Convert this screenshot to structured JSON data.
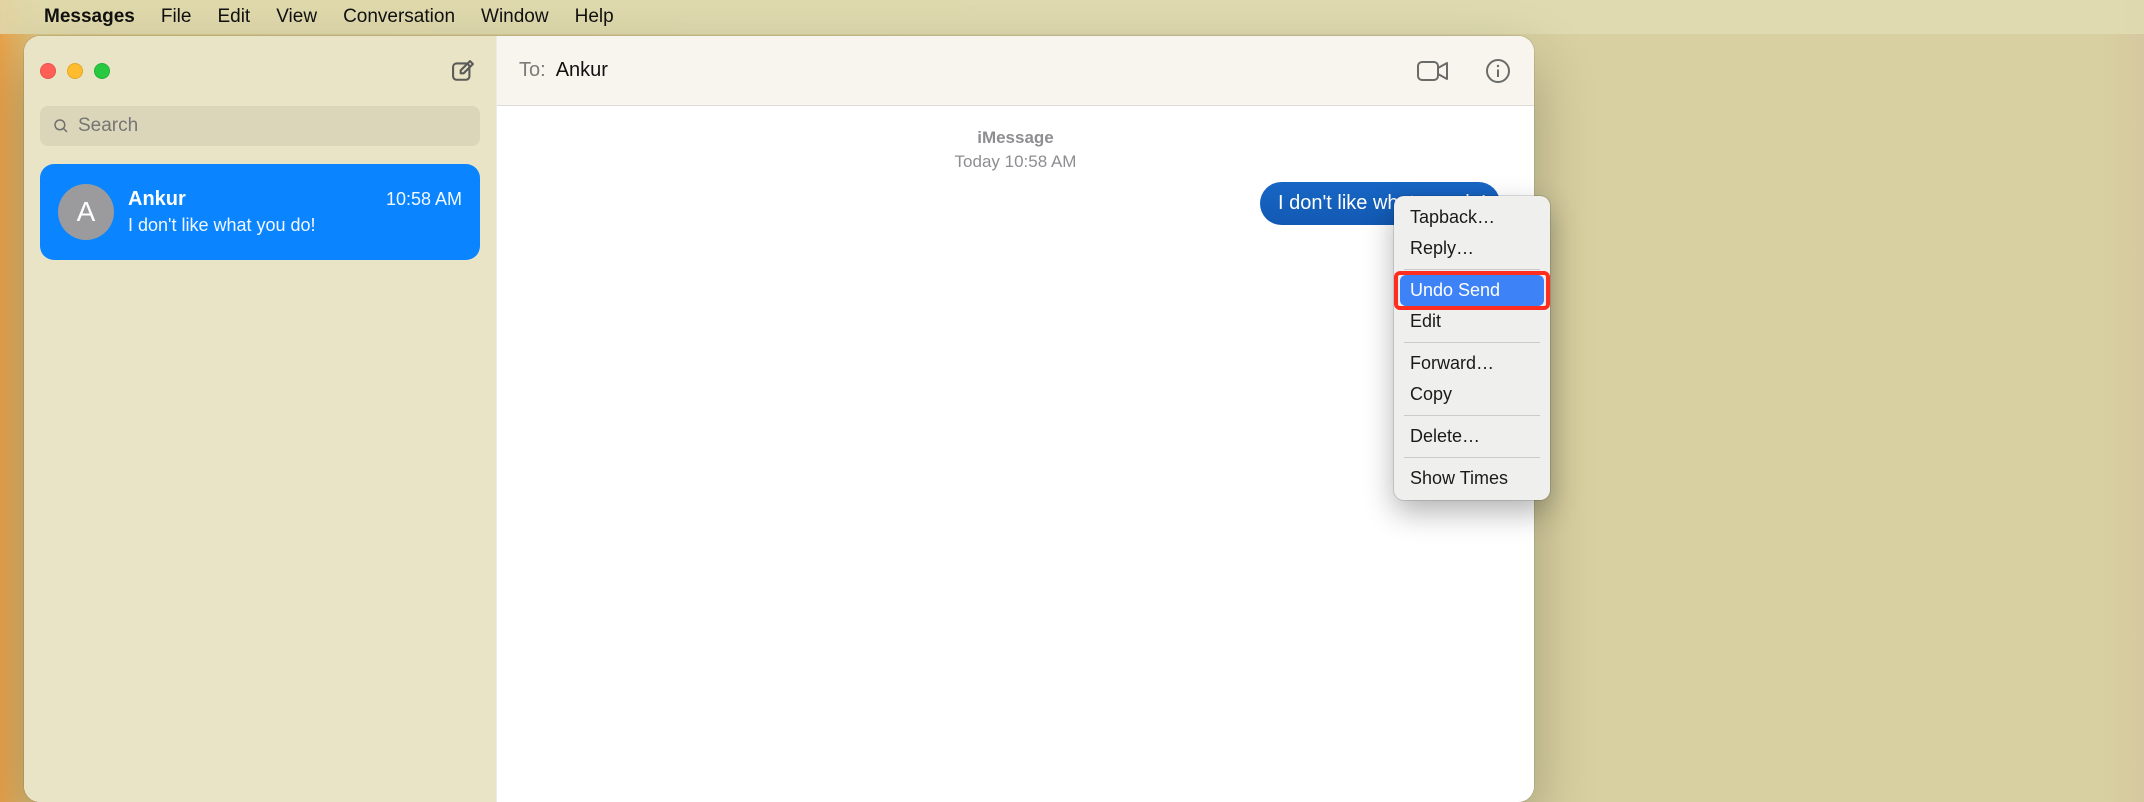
{
  "menubar": {
    "app": "Messages",
    "items": [
      "File",
      "Edit",
      "View",
      "Conversation",
      "Window",
      "Help"
    ]
  },
  "sidebar": {
    "search_placeholder": "Search",
    "compose_icon": "compose",
    "conversations": [
      {
        "avatar_initial": "A",
        "name": "Ankur",
        "time": "10:58 AM",
        "preview": "I don't like what you do!"
      }
    ]
  },
  "header": {
    "to_label": "To:",
    "recipient": "Ankur"
  },
  "thread": {
    "service": "iMessage",
    "timestamp": "Today 10:58 AM",
    "messages": [
      {
        "text": "I don't like what you do!",
        "outgoing": true
      }
    ]
  },
  "context_menu": {
    "items": [
      {
        "label": "Tapback…"
      },
      {
        "label": "Reply…"
      },
      {
        "sep": true
      },
      {
        "label": "Undo Send",
        "highlighted": true,
        "annotated": true
      },
      {
        "label": "Edit"
      },
      {
        "sep": true
      },
      {
        "label": "Forward…"
      },
      {
        "label": "Copy"
      },
      {
        "sep": true
      },
      {
        "label": "Delete…"
      },
      {
        "sep": true
      },
      {
        "label": "Show Times"
      }
    ]
  }
}
